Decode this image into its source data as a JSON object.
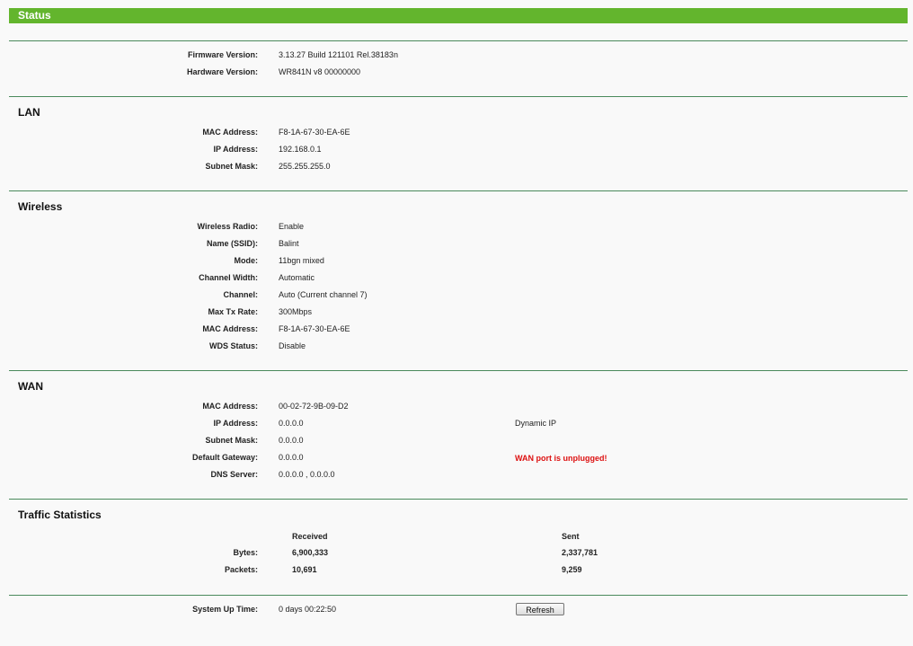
{
  "header": {
    "title": "Status"
  },
  "general": {
    "firmware_label": "Firmware Version:",
    "firmware_value": "3.13.27 Build 121101 Rel.38183n",
    "hardware_label": "Hardware Version:",
    "hardware_value": "WR841N v8 00000000"
  },
  "lan": {
    "title": "LAN",
    "mac_label": "MAC Address:",
    "mac_value": "F8-1A-67-30-EA-6E",
    "ip_label": "IP Address:",
    "ip_value": "192.168.0.1",
    "mask_label": "Subnet Mask:",
    "mask_value": "255.255.255.0"
  },
  "wireless": {
    "title": "Wireless",
    "radio_label": "Wireless Radio:",
    "radio_value": "Enable",
    "ssid_label": "Name (SSID):",
    "ssid_value": "Balint",
    "mode_label": "Mode:",
    "mode_value": "11bgn mixed",
    "width_label": "Channel Width:",
    "width_value": "Automatic",
    "channel_label": "Channel:",
    "channel_value": "Auto (Current channel 7)",
    "rate_label": "Max Tx Rate:",
    "rate_value": "300Mbps",
    "mac_label": "MAC Address:",
    "mac_value": "F8-1A-67-30-EA-6E",
    "wds_label": "WDS Status:",
    "wds_value": "Disable"
  },
  "wan": {
    "title": "WAN",
    "mac_label": "MAC Address:",
    "mac_value": "00-02-72-9B-09-D2",
    "ip_label": "IP Address:",
    "ip_value": "0.0.0.0",
    "ip_type": "Dynamic IP",
    "mask_label": "Subnet Mask:",
    "mask_value": "0.0.0.0",
    "gateway_label": "Default Gateway:",
    "gateway_value": "0.0.0.0",
    "warning": "WAN port is unplugged!",
    "dns_label": "DNS Server:",
    "dns_value": "0.0.0.0 , 0.0.0.0",
    "warning_color": "#dd1111"
  },
  "traffic": {
    "title": "Traffic Statistics",
    "received_header": "Received",
    "sent_header": "Sent",
    "bytes_label": "Bytes:",
    "bytes_received": "6,900,333",
    "bytes_sent": "2,337,781",
    "packets_label": "Packets:",
    "packets_received": "10,691",
    "packets_sent": "9,259"
  },
  "uptime": {
    "label": "System Up Time:",
    "value": "0 days 00:22:50",
    "refresh_label": "Refresh"
  },
  "colors": {
    "header_bg": "#63b52d",
    "divider": "#4a8a5c"
  }
}
